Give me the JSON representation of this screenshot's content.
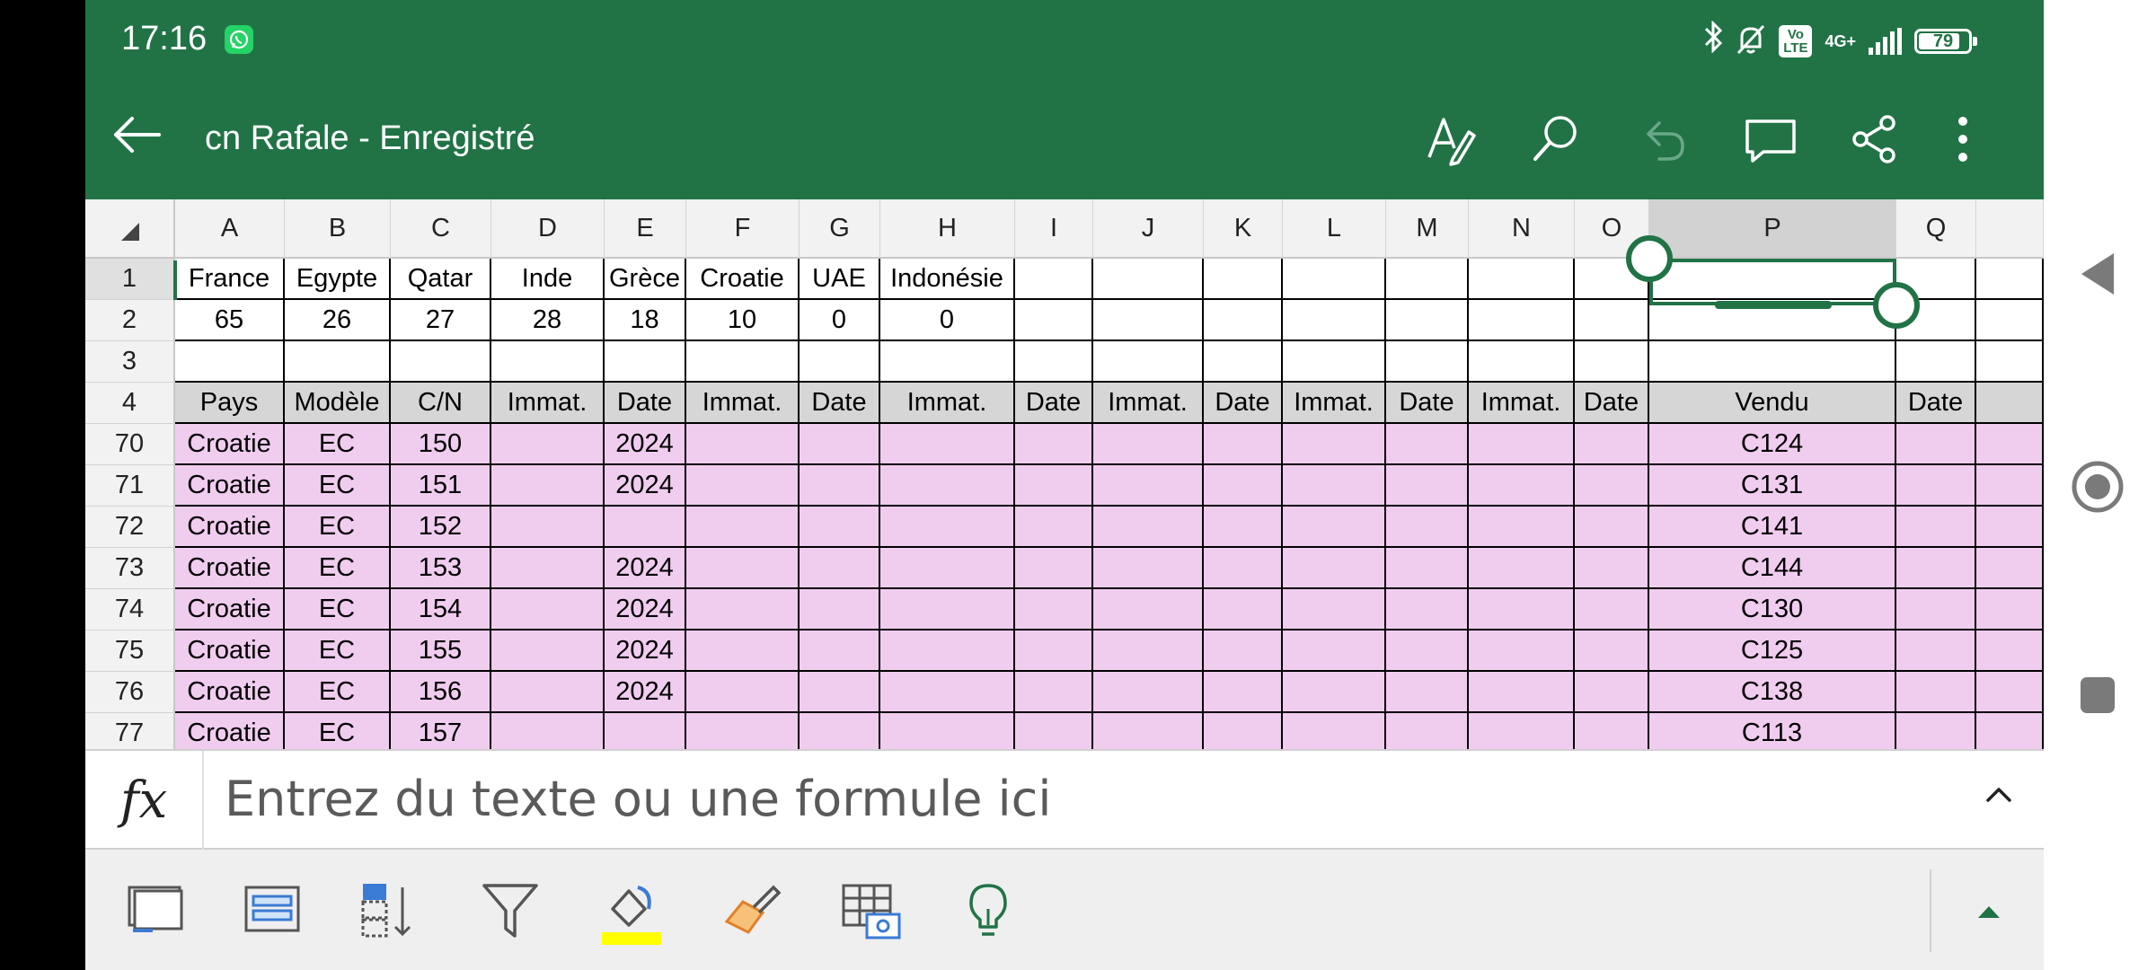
{
  "status_bar": {
    "time": "17:16",
    "volte": "Vo\nLTE",
    "network": "4G+",
    "battery": "79"
  },
  "header": {
    "title": "cn Rafale - Enregistré"
  },
  "toolbar_icons": [
    "draw-pen-icon",
    "search-icon",
    "undo-icon",
    "comment-icon",
    "share-icon",
    "more-options-icon"
  ],
  "sheet": {
    "columns": [
      "A",
      "B",
      "C",
      "D",
      "E",
      "F",
      "G",
      "H",
      "I",
      "J",
      "K",
      "L",
      "M",
      "N",
      "O",
      "P",
      "Q"
    ],
    "rows": [
      {
        "num": "1",
        "type": "plain",
        "cells": [
          "France",
          "Egypte",
          "Qatar",
          "Inde",
          "Grèce",
          "Croatie",
          "UAE",
          "Indonésie",
          "",
          "",
          "",
          "",
          "",
          "",
          "",
          "",
          ""
        ]
      },
      {
        "num": "2",
        "type": "plain",
        "cells": [
          "65",
          "26",
          "27",
          "28",
          "18",
          "10",
          "0",
          "0",
          "",
          "",
          "",
          "",
          "",
          "",
          "",
          "",
          ""
        ]
      },
      {
        "num": "3",
        "type": "plain",
        "cells": [
          "",
          "",
          "",
          "",
          "",
          "",
          "",
          "",
          "",
          "",
          "",
          "",
          "",
          "",
          "",
          "",
          ""
        ]
      },
      {
        "num": "4",
        "type": "header",
        "cells": [
          "Pays",
          "Modèle",
          "C/N",
          "Immat.",
          "Date",
          "Immat.",
          "Date",
          "Immat.",
          "Date",
          "Immat.",
          "Date",
          "Immat.",
          "Date",
          "Immat.",
          "Date",
          "Vendu",
          "Date"
        ]
      },
      {
        "num": "70",
        "type": "pink",
        "cells": [
          "Croatie",
          "EC",
          "150",
          "",
          "2024",
          "",
          "",
          "",
          "",
          "",
          "",
          "",
          "",
          "",
          "",
          "C124",
          ""
        ]
      },
      {
        "num": "71",
        "type": "pink",
        "cells": [
          "Croatie",
          "EC",
          "151",
          "",
          "2024",
          "",
          "",
          "",
          "",
          "",
          "",
          "",
          "",
          "",
          "",
          "C131",
          ""
        ]
      },
      {
        "num": "72",
        "type": "pink",
        "cells": [
          "Croatie",
          "EC",
          "152",
          "",
          "",
          "",
          "",
          "",
          "",
          "",
          "",
          "",
          "",
          "",
          "",
          "C141",
          ""
        ]
      },
      {
        "num": "73",
        "type": "pink",
        "cells": [
          "Croatie",
          "EC",
          "153",
          "",
          "2024",
          "",
          "",
          "",
          "",
          "",
          "",
          "",
          "",
          "",
          "",
          "C144",
          ""
        ]
      },
      {
        "num": "74",
        "type": "pink",
        "cells": [
          "Croatie",
          "EC",
          "154",
          "",
          "2024",
          "",
          "",
          "",
          "",
          "",
          "",
          "",
          "",
          "",
          "",
          "C130",
          ""
        ]
      },
      {
        "num": "75",
        "type": "pink",
        "cells": [
          "Croatie",
          "EC",
          "155",
          "",
          "2024",
          "",
          "",
          "",
          "",
          "",
          "",
          "",
          "",
          "",
          "",
          "C125",
          ""
        ]
      },
      {
        "num": "76",
        "type": "pink",
        "cells": [
          "Croatie",
          "EC",
          "156",
          "",
          "2024",
          "",
          "",
          "",
          "",
          "",
          "",
          "",
          "",
          "",
          "",
          "C138",
          ""
        ]
      },
      {
        "num": "77",
        "type": "pink",
        "cells": [
          "Croatie",
          "EC",
          "157",
          "",
          "",
          "",
          "",
          "",
          "",
          "",
          "",
          "",
          "",
          "",
          "",
          "C113",
          ""
        ]
      }
    ],
    "selected": {
      "row": "1",
      "column": "P"
    }
  },
  "formula_bar": {
    "fx_label": "fx",
    "placeholder": "Entrez du texte ou une formule ici"
  },
  "bottom_toolbar_icons": [
    "freeze-panes-icon",
    "select-rows-icon",
    "sort-icon",
    "filter-icon",
    "fill-color-icon",
    "format-painter-icon",
    "insert-table-picture-icon",
    "ideas-bulb-icon"
  ],
  "colors": {
    "excel_green": "#217346",
    "pink_fill": "#f0cdef",
    "fill_color_highlight": "#ffff00"
  }
}
